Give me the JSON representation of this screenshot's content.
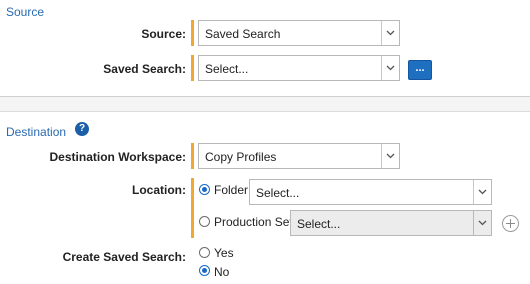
{
  "source": {
    "title": "Source",
    "source_label": "Source:",
    "source_value": "Saved Search",
    "saved_search_label": "Saved Search:",
    "saved_search_value": "Select...",
    "browse_button_label": "..."
  },
  "destination": {
    "title": "Destination",
    "help_icon_label": "?",
    "workspace_label": "Destination Workspace:",
    "workspace_value": "Copy Profiles",
    "location_label": "Location:",
    "location_options": [
      {
        "label": "Folder",
        "selected": true,
        "value": "Select..."
      },
      {
        "label": "Production Set",
        "selected": false,
        "value": "Select..."
      }
    ],
    "create_saved_search_label": "Create Saved Search:",
    "create_saved_search_options": [
      {
        "label": "Yes",
        "selected": false
      },
      {
        "label": "No",
        "selected": true
      }
    ]
  },
  "colors": {
    "accent": "#2a6bb0",
    "required_bar": "#f0a830",
    "radio_selected": "#1668c8",
    "button": "#1f6fc0"
  },
  "icons": [
    "chevron-down-icon",
    "help-icon",
    "plus-circle-icon",
    "radio-icon"
  ]
}
